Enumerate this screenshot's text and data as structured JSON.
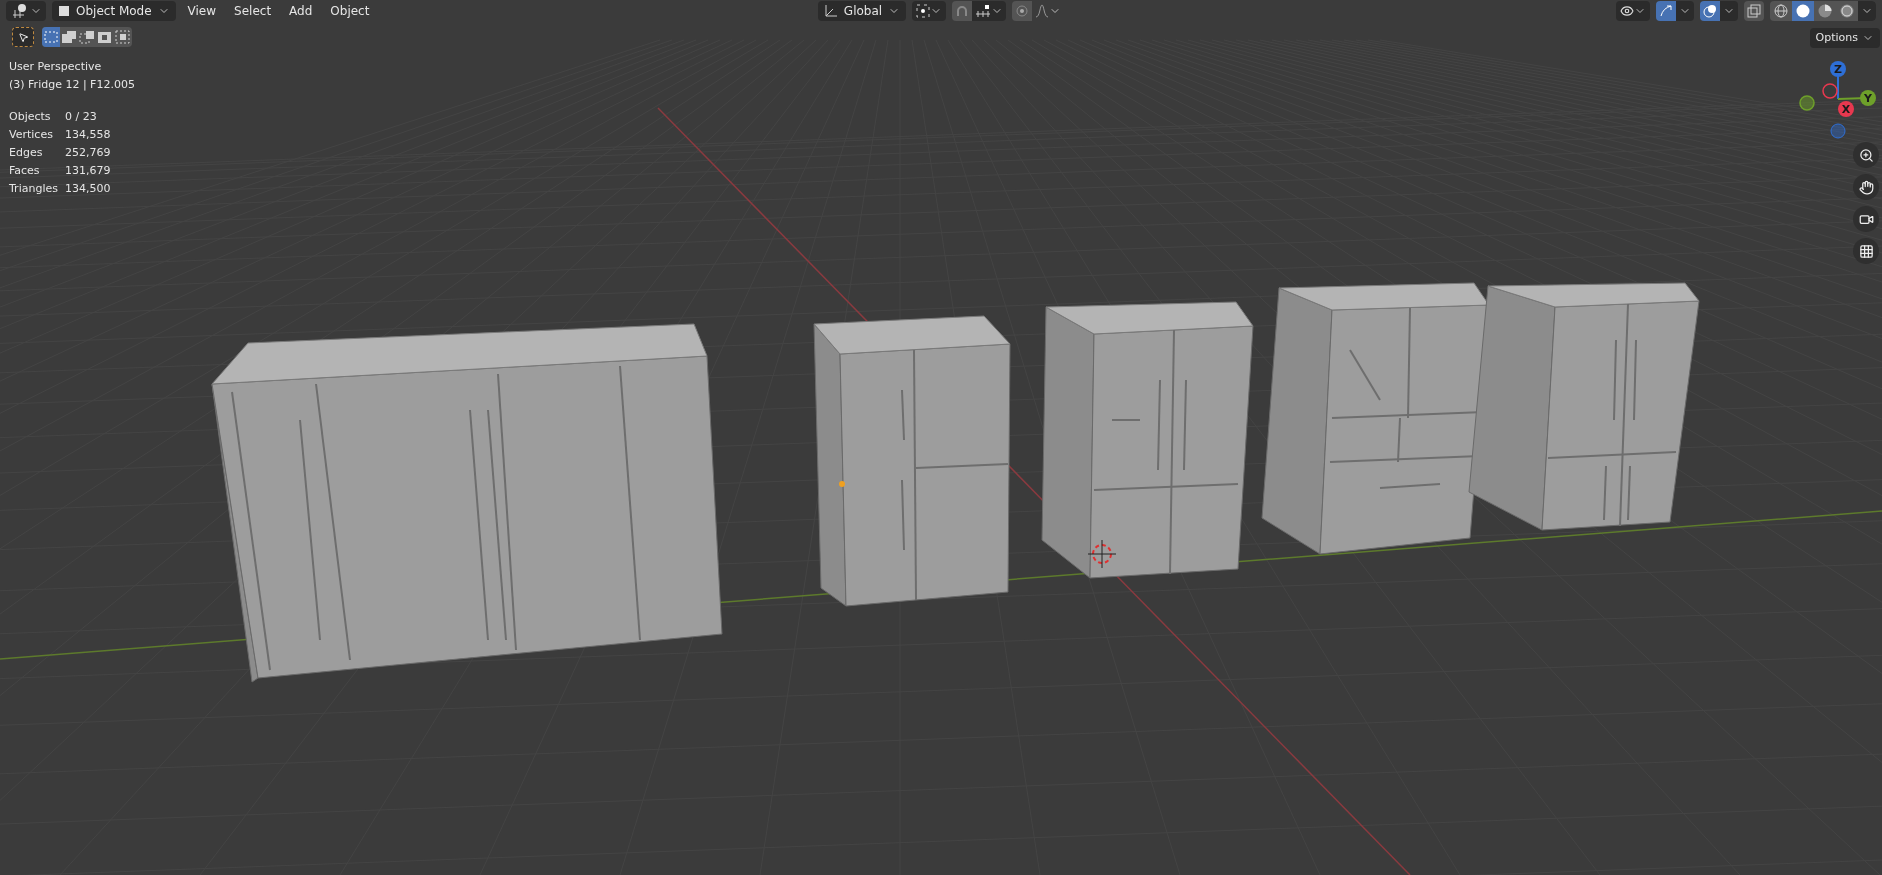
{
  "header": {
    "mode": "Object Mode",
    "menus": [
      "View",
      "Select",
      "Add",
      "Object"
    ],
    "orientation": "Global",
    "snap": {
      "on": false
    },
    "proportional": {
      "on": false
    },
    "gizmos": {
      "on": true
    },
    "overlays": {
      "on": true
    },
    "xray": {
      "on": false
    },
    "shading": [
      {
        "kind": "wireframe",
        "selected": false
      },
      {
        "kind": "solid",
        "selected": true
      },
      {
        "kind": "material",
        "selected": false
      },
      {
        "kind": "rendered",
        "selected": false
      }
    ]
  },
  "select_modes": [
    {
      "kind": "new",
      "selected": true
    },
    {
      "kind": "extend",
      "selected": false
    },
    {
      "kind": "subtract",
      "selected": false
    },
    {
      "kind": "difference",
      "selected": false
    },
    {
      "kind": "intersect",
      "selected": false
    }
  ],
  "viewport": {
    "view_name": "User Perspective",
    "object_info": "(3) Fridge 12 | F12.005",
    "stats": [
      {
        "label": "Objects",
        "value": "0 / 23"
      },
      {
        "label": "Vertices",
        "value": "134,558"
      },
      {
        "label": "Edges",
        "value": "252,769"
      },
      {
        "label": "Faces",
        "value": "131,679"
      },
      {
        "label": "Triangles",
        "value": "134,500"
      }
    ],
    "options": "Options",
    "axes": [
      {
        "label": "Z",
        "color": "#2e6fd6"
      },
      {
        "label": "Y",
        "color": "#6ea02a"
      },
      {
        "label": "X",
        "color": "#e8384f"
      }
    ]
  }
}
